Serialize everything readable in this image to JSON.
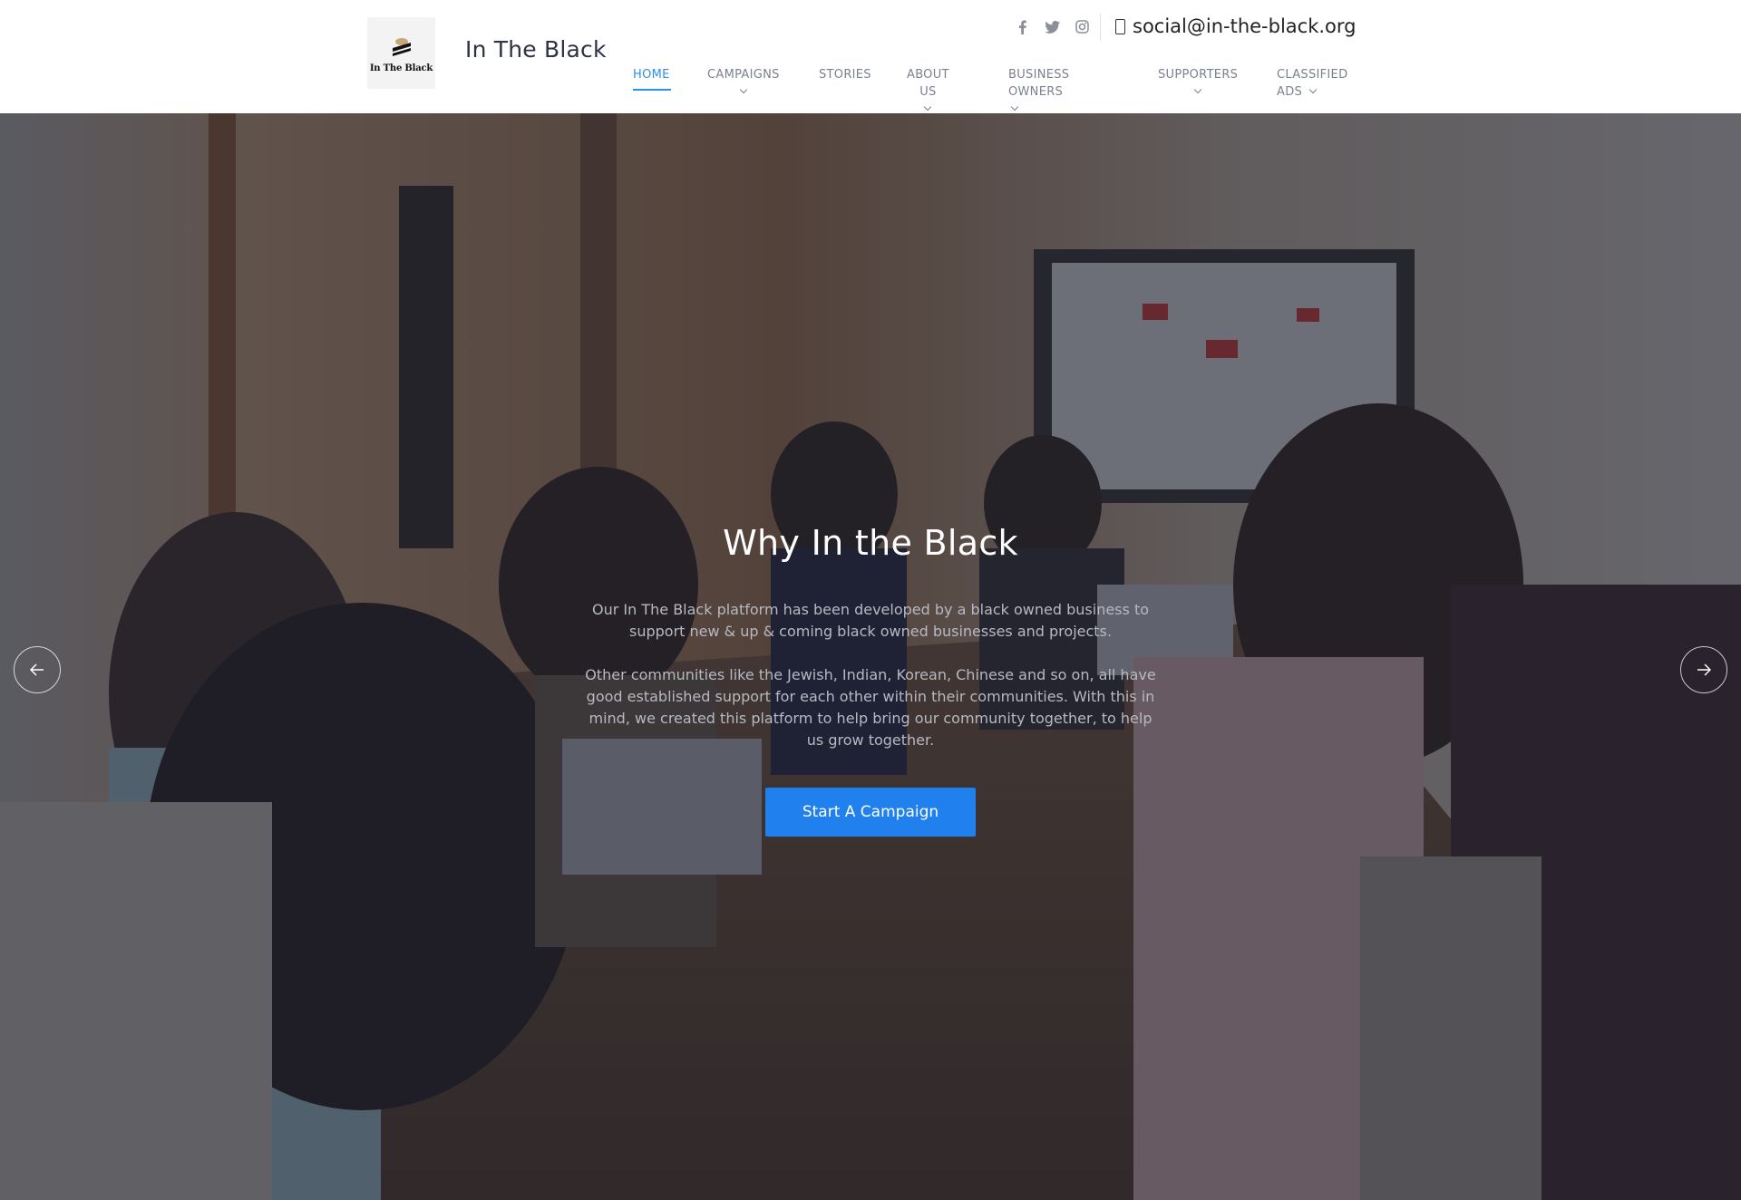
{
  "brand": {
    "logo_text": "In The Black",
    "title": "In The Black"
  },
  "social": {
    "icons": [
      "facebook-icon",
      "twitter-icon",
      "instagram-icon"
    ],
    "email": "social@in-the-black.org"
  },
  "nav": {
    "items": [
      {
        "label": "HOME",
        "active": true
      },
      {
        "label": "CAMPAIGNS",
        "dropdown": true
      },
      {
        "label": "STORIES"
      },
      {
        "label": "ABOUT US",
        "dropdown": true
      },
      {
        "label_line1": "BUSINESS",
        "label_line2": "OWNERS",
        "dropdown": true
      },
      {
        "label": "SUPPORTERS",
        "dropdown": true
      },
      {
        "label_line1": "CLASSIFIED",
        "label_line2": "ADS",
        "dropdown": true
      }
    ]
  },
  "hero": {
    "title": "Why In the Black",
    "paragraph1": "Our In The Black platform has been developed by a black owned business to support new & up & coming black owned businesses and projects.",
    "paragraph2": "Other communities like the Jewish, Indian, Korean, Chinese and so on, all have good established support for each other within their communities. With this in mind, we created this platform to help bring our community together, to help us grow together.",
    "cta_label": "Start A Campaign"
  },
  "colors": {
    "accent": "#1f80ee",
    "nav_active": "#2f8ef0",
    "nav_text": "#7a8190"
  }
}
